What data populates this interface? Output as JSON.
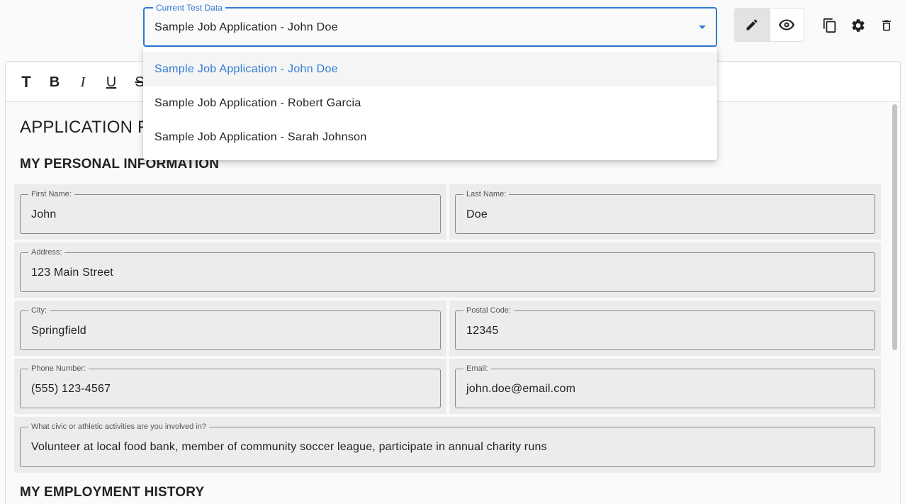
{
  "test_data_select": {
    "legend": "Current Test Data",
    "value": "Sample Job Application - John Doe",
    "options": [
      {
        "label": "Sample Job Application - John Doe",
        "selected": true
      },
      {
        "label": "Sample Job Application - Robert Garcia",
        "selected": false
      },
      {
        "label": "Sample Job Application - Sarah Johnson",
        "selected": false
      }
    ]
  },
  "toolbar": {
    "icons": [
      "pencil-icon",
      "eye-icon",
      "copy-icon",
      "gear-icon",
      "trash-icon"
    ],
    "format_buttons": [
      "T",
      "B",
      "I",
      "U",
      "S"
    ]
  },
  "document": {
    "title": "APPLICATION FO",
    "sections": {
      "personal": "MY PERSONAL INFORMATION",
      "employment": "MY EMPLOYMENT HISTORY"
    },
    "fields": {
      "first_name": {
        "label": "First Name:",
        "value": "John"
      },
      "last_name": {
        "label": "Last Name:",
        "value": "Doe"
      },
      "address": {
        "label": "Address:",
        "value": "123 Main Street"
      },
      "city": {
        "label": "City:",
        "value": "Springfield"
      },
      "postal_code": {
        "label": "Postal Code:",
        "value": "12345"
      },
      "phone": {
        "label": "Phone Number:",
        "value": "(555) 123-4567"
      },
      "email": {
        "label": "Email:",
        "value": "john.doe@email.com"
      },
      "activities": {
        "label": "What civic or athletic activities are you involved in?",
        "value": "Volunteer at local food bank, member of community soccer league, participate in annual charity runs"
      }
    }
  },
  "colors": {
    "accent": "#2f7ad6",
    "field_bg": "#ececec",
    "active_toggle": "#e3e3e3"
  }
}
